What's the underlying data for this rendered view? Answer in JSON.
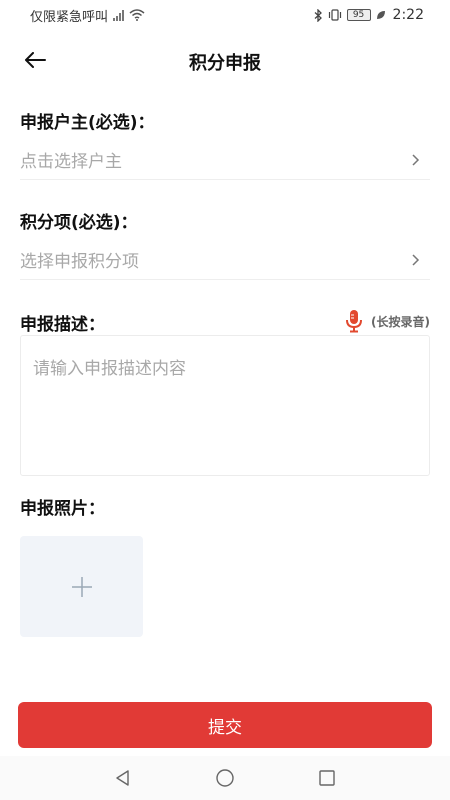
{
  "status_bar": {
    "carrier": "仅限紧急呼叫",
    "battery": "95",
    "time": "2:22"
  },
  "header": {
    "title": "积分申报"
  },
  "form": {
    "household": {
      "label": "申报户主(必选)：",
      "placeholder": "点击选择户主"
    },
    "item": {
      "label": "积分项(必选)：",
      "placeholder": "选择申报积分项"
    },
    "description": {
      "label": "申报描述：",
      "voice_hint": "(长按录音)",
      "placeholder": "请输入申报描述内容"
    },
    "photo": {
      "label": "申报照片："
    }
  },
  "actions": {
    "submit_label": "提交"
  },
  "colors": {
    "accent": "#e13a36",
    "placeholder": "#a8a8a8",
    "photo_bg": "#f1f4f9"
  }
}
